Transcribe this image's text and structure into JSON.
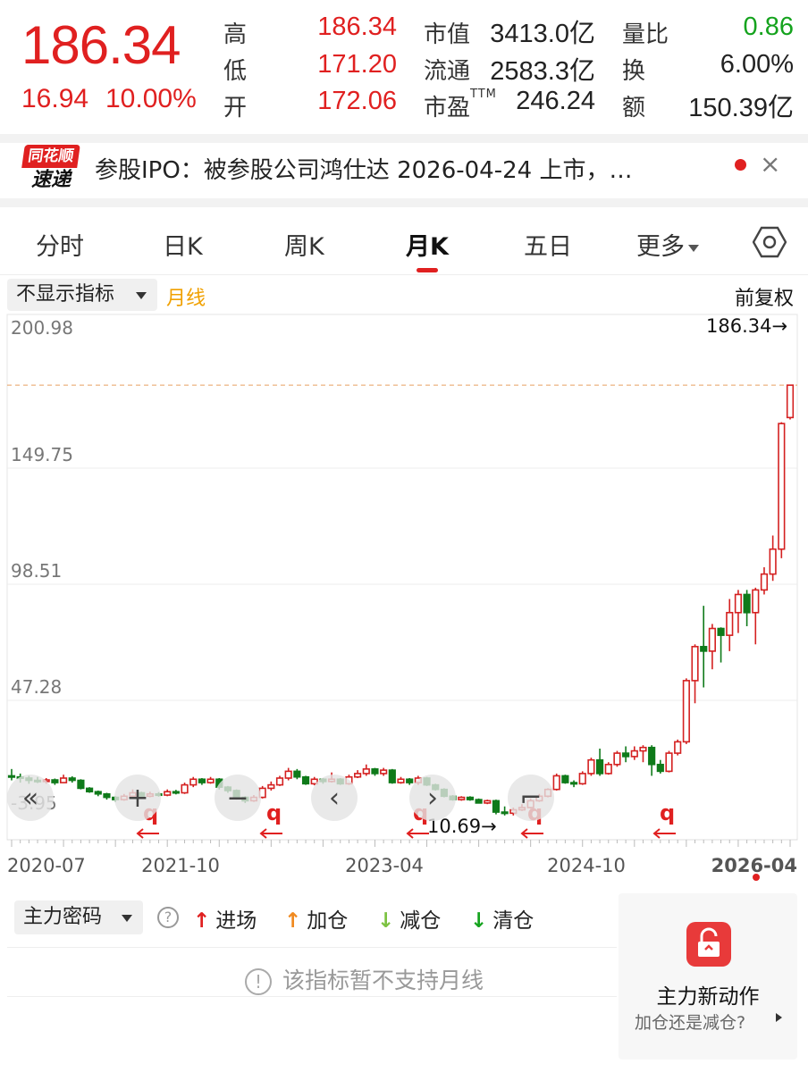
{
  "quote": {
    "price": "186.34",
    "change": "16.94",
    "change_pct": "10.00%",
    "stats": [
      {
        "label": "高",
        "value": "186.34"
      },
      {
        "label": "低",
        "value": "171.20"
      },
      {
        "label": "开",
        "value": "172.06"
      },
      {
        "label": "市值",
        "value": "3413.0亿"
      },
      {
        "label": "流通",
        "value": "2583.3亿"
      },
      {
        "label": "市盈",
        "label_sup": "TTM",
        "value": "246.24"
      },
      {
        "label": "量比",
        "value": "0.86"
      },
      {
        "label": "换",
        "value": "6.00%"
      },
      {
        "label": "额",
        "value": "150.39亿"
      }
    ]
  },
  "news": {
    "logo_top": "同花顺",
    "logo_bottom": "速递",
    "text": "参股IPO：被参股公司鸿仕达 2026-04-24 上市，…",
    "close_icon": "×"
  },
  "tabs": [
    {
      "label": "分时",
      "active": false
    },
    {
      "label": "日K",
      "active": false
    },
    {
      "label": "周K",
      "active": false
    },
    {
      "label": "月K",
      "active": true
    },
    {
      "label": "五日",
      "active": false
    },
    {
      "label": "更多",
      "active": false
    }
  ],
  "chart_toolbar": {
    "indicator": "不显示指标",
    "ma_label": "月线",
    "adjust": "前复权"
  },
  "chart_data": {
    "type": "candlestick",
    "y_ticks": [
      "200.98",
      "149.75",
      "98.51",
      "47.28",
      "-3.95"
    ],
    "ylim": [
      -3.95,
      200.98
    ],
    "x_ticks": [
      "2020-07",
      "2021-10",
      "2023-04",
      "2024-10",
      "2026-04"
    ],
    "max_label": "186.34→",
    "min_label": "10.69→",
    "marker_label": "q",
    "colors": {
      "up": "#d42020",
      "down": "#0f7a1a"
    },
    "candles": [
      [
        14.0,
        13.5,
        17.0,
        12.0
      ],
      [
        13.5,
        13.0,
        15.0,
        11.0
      ],
      [
        13.0,
        12.0,
        14.0,
        10.5
      ],
      [
        12.0,
        11.5,
        13.5,
        10.8
      ],
      [
        11.5,
        12.2,
        13.0,
        10.5
      ],
      [
        12.2,
        11.0,
        12.8,
        10.0
      ],
      [
        11.0,
        13.0,
        14.5,
        10.8
      ],
      [
        13.0,
        12.0,
        13.8,
        11.0
      ],
      [
        12.0,
        8.5,
        12.5,
        8.0
      ],
      [
        8.5,
        7.0,
        9.0,
        6.5
      ],
      [
        7.0,
        6.0,
        7.5,
        5.0
      ],
      [
        6.0,
        4.5,
        6.5,
        3.5
      ],
      [
        4.5,
        3.5,
        5.0,
        2.5
      ],
      [
        3.5,
        5.0,
        6.0,
        3.0
      ],
      [
        5.0,
        6.5,
        8.0,
        4.5
      ],
      [
        6.5,
        5.0,
        7.0,
        4.0
      ],
      [
        5.0,
        6.0,
        7.0,
        4.5
      ],
      [
        6.0,
        5.5,
        6.8,
        4.8
      ],
      [
        5.5,
        7.0,
        8.0,
        5.0
      ],
      [
        7.0,
        6.5,
        7.8,
        5.8
      ],
      [
        6.5,
        10.0,
        11.0,
        6.0
      ],
      [
        10.0,
        12.5,
        13.5,
        9.0
      ],
      [
        12.5,
        11.0,
        13.0,
        10.0
      ],
      [
        11.0,
        12.5,
        13.5,
        10.5
      ],
      [
        12.5,
        9.0,
        13.0,
        8.0
      ],
      [
        9.0,
        7.5,
        9.5,
        6.5
      ],
      [
        7.5,
        4.5,
        8.0,
        3.5
      ],
      [
        4.5,
        3.0,
        5.0,
        2.0
      ],
      [
        3.0,
        4.5,
        5.5,
        2.5
      ],
      [
        4.5,
        8.5,
        9.5,
        4.0
      ],
      [
        8.5,
        10.0,
        11.5,
        7.5
      ],
      [
        10.0,
        13.0,
        14.0,
        9.5
      ],
      [
        13.0,
        16.0,
        17.5,
        12.0
      ],
      [
        16.0,
        13.5,
        17.0,
        12.5
      ],
      [
        13.5,
        10.5,
        14.0,
        10.0
      ],
      [
        10.5,
        12.5,
        13.5,
        9.8
      ],
      [
        12.5,
        11.5,
        13.0,
        10.5
      ],
      [
        11.5,
        12.5,
        15.5,
        11.0
      ],
      [
        12.5,
        10.5,
        13.0,
        10.0
      ],
      [
        10.5,
        13.5,
        14.5,
        10.0
      ],
      [
        13.5,
        15.0,
        16.5,
        13.0
      ],
      [
        15.0,
        17.0,
        19.0,
        14.0
      ],
      [
        17.0,
        15.0,
        17.5,
        14.0
      ],
      [
        15.0,
        16.5,
        17.5,
        14.0
      ],
      [
        16.5,
        11.0,
        17.0,
        10.5
      ],
      [
        11.0,
        12.5,
        13.5,
        10.5
      ],
      [
        12.5,
        11.0,
        13.0,
        10.0
      ],
      [
        11.0,
        13.0,
        14.0,
        10.0
      ],
      [
        13.0,
        10.0,
        13.5,
        9.5
      ],
      [
        10.0,
        8.0,
        10.5,
        7.5
      ],
      [
        8.0,
        5.0,
        8.5,
        4.5
      ],
      [
        5.0,
        3.5,
        5.5,
        3.0
      ],
      [
        3.5,
        4.5,
        5.0,
        3.0
      ],
      [
        4.5,
        3.5,
        5.0,
        3.0
      ],
      [
        3.5,
        2.0,
        4.0,
        1.8
      ],
      [
        2.0,
        3.0,
        3.5,
        1.5
      ],
      [
        3.0,
        -2.0,
        3.5,
        -3.0
      ],
      [
        -2.0,
        -2.5,
        0.5,
        -3.5
      ],
      [
        -2.5,
        -1.0,
        0.0,
        -3.5
      ],
      [
        -1.0,
        0.0,
        1.5,
        -1.5
      ],
      [
        0.0,
        3.0,
        4.0,
        -0.5
      ],
      [
        3.0,
        5.0,
        6.0,
        2.5
      ],
      [
        5.0,
        8.0,
        8.5,
        4.5
      ],
      [
        8.0,
        14.0,
        15.0,
        7.5
      ],
      [
        14.0,
        11.0,
        14.5,
        10.5
      ],
      [
        11.0,
        10.5,
        12.0,
        9.0
      ],
      [
        10.5,
        15.0,
        16.0,
        10.0
      ],
      [
        15.0,
        21.0,
        22.0,
        14.0
      ],
      [
        21.0,
        15.0,
        26.0,
        14.0
      ],
      [
        15.0,
        19.0,
        20.0,
        14.5
      ],
      [
        19.0,
        24.0,
        25.0,
        18.0
      ],
      [
        24.0,
        22.5,
        27.0,
        20.0
      ],
      [
        22.5,
        25.0,
        27.0,
        21.0
      ],
      [
        25.0,
        26.5,
        27.5,
        20.0
      ],
      [
        26.5,
        19.0,
        27.5,
        14.0
      ],
      [
        19.0,
        16.0,
        21.0,
        15.0
      ],
      [
        16.0,
        24.0,
        25.0,
        15.5
      ],
      [
        24.0,
        29.0,
        30.0,
        23.0
      ],
      [
        29.0,
        56.0,
        57.0,
        28.0
      ],
      [
        56.0,
        71.0,
        72.0,
        46.0
      ],
      [
        71.0,
        69.0,
        89.0,
        53.0
      ],
      [
        69.0,
        79.0,
        81.0,
        61.0
      ],
      [
        79.0,
        76.0,
        79.5,
        64.0
      ],
      [
        76.0,
        86.0,
        92.0,
        69.0
      ],
      [
        86.0,
        94.0,
        96.0,
        77.0
      ],
      [
        94.0,
        86.0,
        96.0,
        80.0
      ],
      [
        86.0,
        96.0,
        97.0,
        72.0
      ],
      [
        96.0,
        103.0,
        106.0,
        94.0
      ],
      [
        103.0,
        114.0,
        120.0,
        100.0
      ],
      [
        114.0,
        169.4,
        170.0,
        110.0
      ],
      [
        172.06,
        186.34,
        186.34,
        171.2
      ]
    ]
  },
  "chart_controls": [
    "«",
    "+",
    "−",
    "‹",
    "›",
    "⌐"
  ],
  "main_force": {
    "selector": "主力密码",
    "legend": [
      {
        "arrow": "↑",
        "label": "进场",
        "color": "#e02020"
      },
      {
        "arrow": "↑",
        "label": "加仓",
        "color": "#f08a20"
      },
      {
        "arrow": "↓",
        "label": "减仓",
        "color": "#7cc241"
      },
      {
        "arrow": "↓",
        "label": "清仓",
        "color": "#15a31e"
      }
    ],
    "unsupported": "该指标暂不支持月线",
    "help_icon": "?",
    "info_icon": "!"
  },
  "promo": {
    "title": "主力新动作",
    "subtitle": "加仓还是减仓?"
  }
}
